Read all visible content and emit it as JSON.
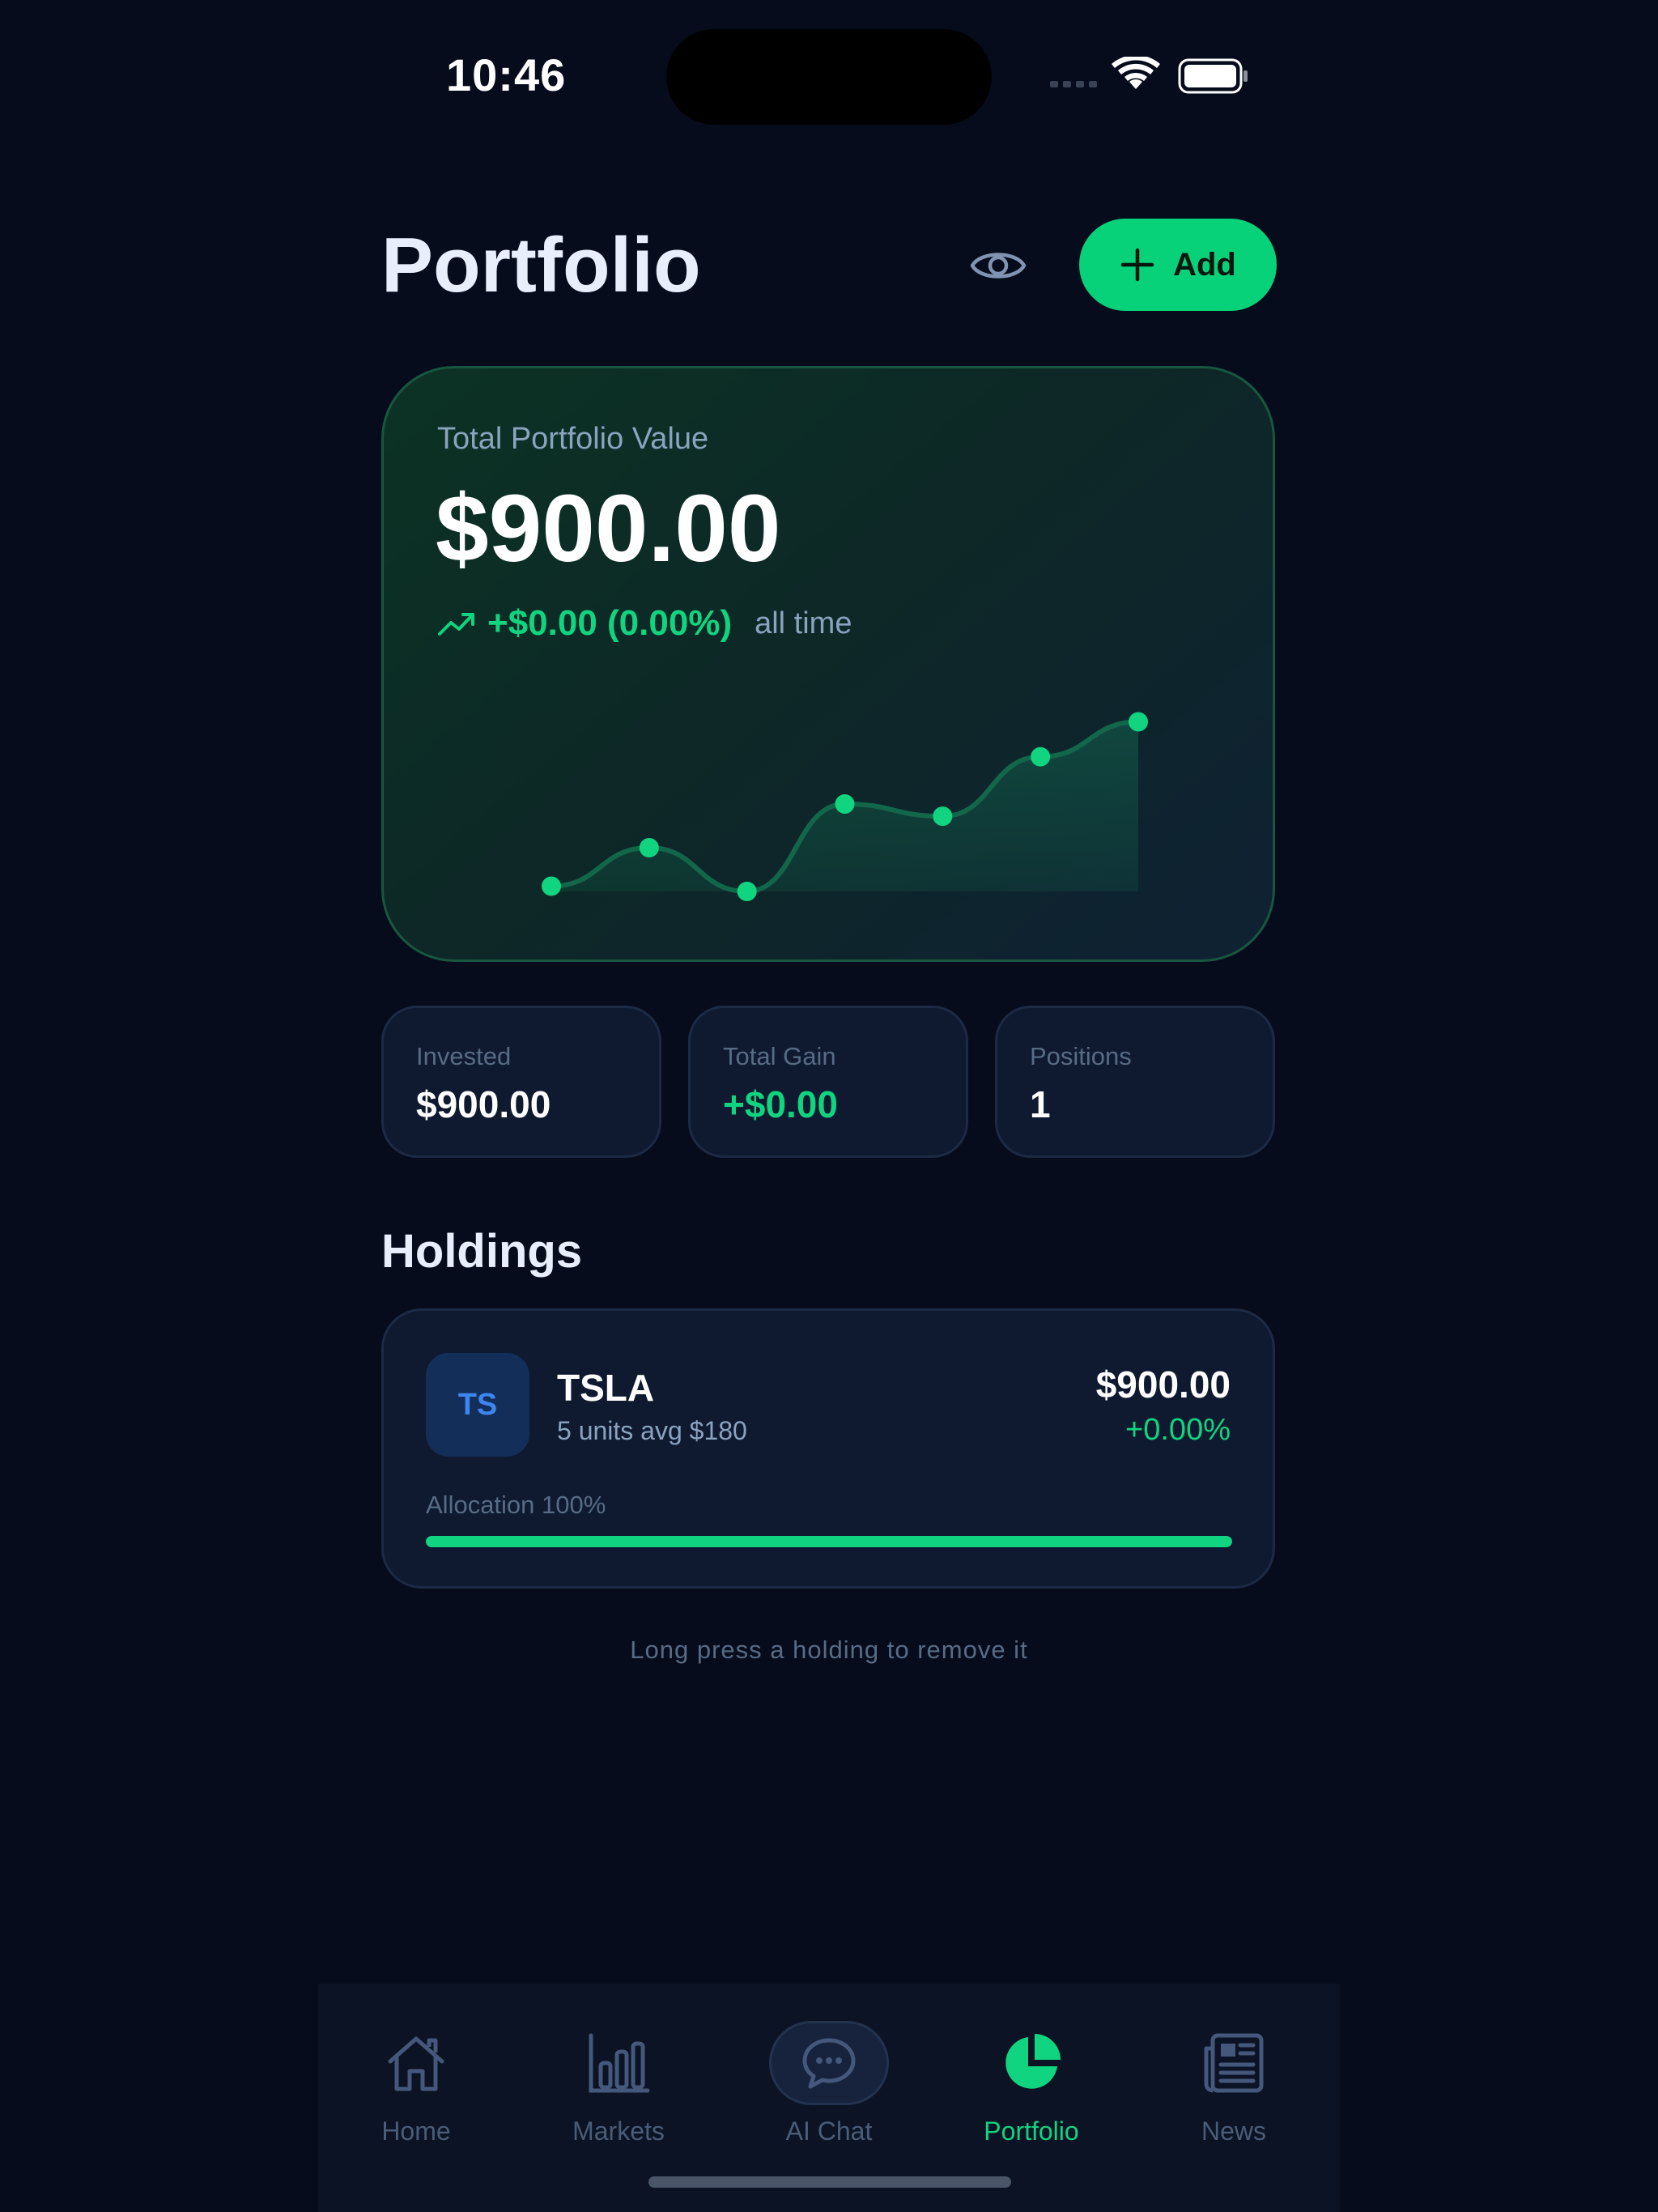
{
  "status_bar": {
    "time": "10:46"
  },
  "header": {
    "title": "Portfolio",
    "visibility_icon": "eye-icon",
    "add_label": "Add"
  },
  "summary": {
    "label": "Total Portfolio Value",
    "value": "$900.00",
    "change": "+$0.00 (0.00%)",
    "period": "all time",
    "change_icon": "trending-up-icon"
  },
  "chart_data": {
    "type": "area",
    "x": [
      1,
      2,
      3,
      4,
      5,
      6,
      7
    ],
    "values": [
      0.03,
      0.25,
      0.0,
      0.5,
      0.43,
      0.77,
      0.97
    ],
    "grid": false,
    "legend": "none"
  },
  "stats": [
    {
      "label": "Invested",
      "value": "$900.00"
    },
    {
      "label": "Total Gain",
      "value": "+$0.00"
    },
    {
      "label": "Positions",
      "value": "1"
    }
  ],
  "holdings": {
    "title": "Holdings",
    "items": [
      {
        "badge": "TS",
        "ticker": "TSLA",
        "detail": "5 units avg $180",
        "value": "$900.00",
        "change": "+0.00%",
        "allocation_label": "Allocation 100%",
        "allocation": 1.0
      }
    ],
    "hint": "Long press a holding to remove it"
  },
  "tabs": [
    {
      "label": "Home",
      "icon": "home-icon",
      "active": false
    },
    {
      "label": "Markets",
      "icon": "bar-chart-icon",
      "active": false
    },
    {
      "label": "AI Chat",
      "icon": "chat-bubble-icon",
      "active": false
    },
    {
      "label": "Portfolio",
      "icon": "pie-chart-icon",
      "active": true
    },
    {
      "label": "News",
      "icon": "newspaper-icon",
      "active": false
    }
  ],
  "colors": {
    "background": "#070c1c",
    "accent": "#10d47f",
    "card": "#0f1a30",
    "muted": "#586b85"
  }
}
